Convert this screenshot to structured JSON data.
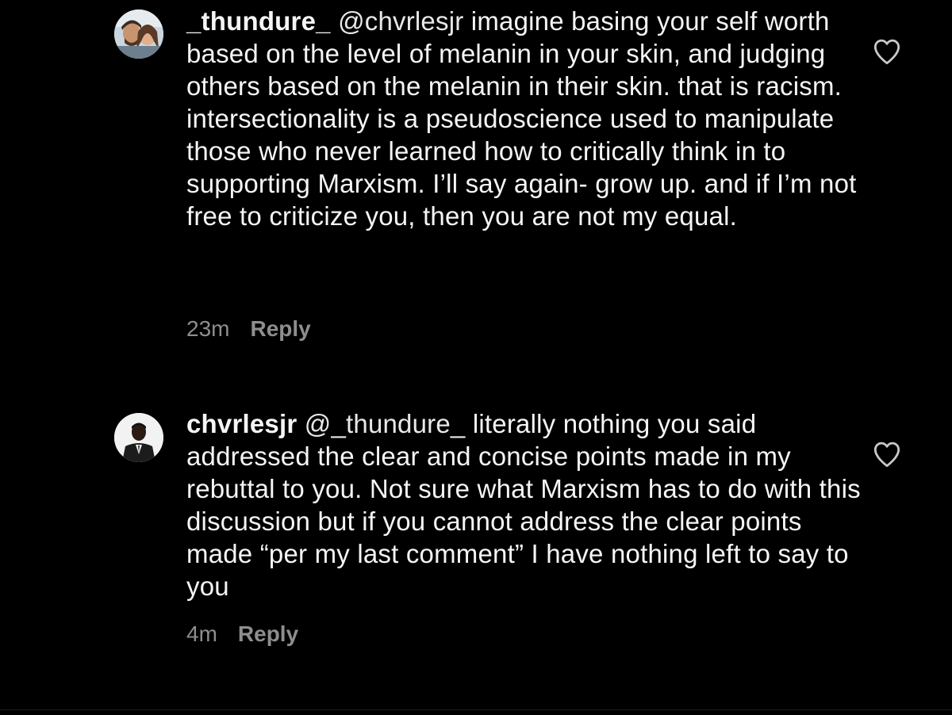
{
  "comments": [
    {
      "username": "_thundure_",
      "mention": "@chvrlesjr",
      "body": "imagine basing your self worth based on the level of melanin in your skin, and judging others based on the melanin in their skin. that is racism. intersectionality is a pseudoscience used to manipulate those who never learned how to critically think in to supporting Marxism. I’ll say again- grow up. and if I’m not free to criticize you, then you are not my equal.",
      "time": "23m",
      "reply_label": "Reply",
      "like_icon": "heart-outline-icon"
    },
    {
      "username": "chvrlesjr",
      "mention": "@_thundure_",
      "body": "literally nothing you said addressed the clear and concise points made in my rebuttal to you. Not sure what Marxism has to do with this discussion but if you cannot address the clear points made “per my last comment” I have nothing left to say to you",
      "time": "4m",
      "reply_label": "Reply",
      "like_icon": "heart-outline-icon"
    }
  ],
  "colors": {
    "background": "#000000",
    "text": "#f5f5f5",
    "secondary": "#8e8e8e"
  }
}
